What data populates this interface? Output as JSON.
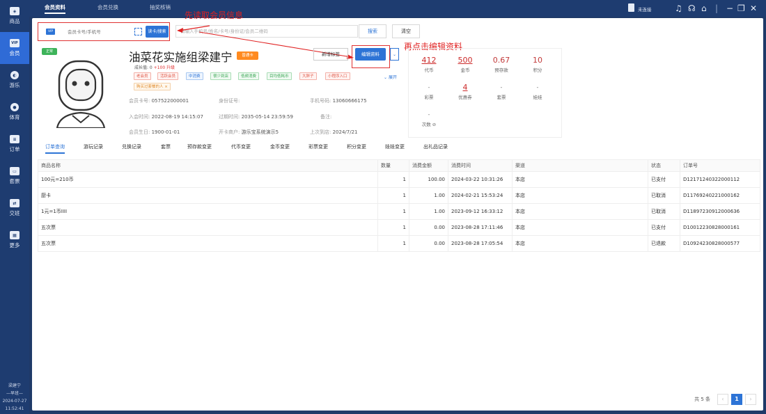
{
  "sidebar": {
    "items": [
      {
        "label": "商品",
        "icon": "shop-icon"
      },
      {
        "label": "会员",
        "icon": "vip-icon"
      },
      {
        "label": "游乐",
        "icon": "game-icon"
      },
      {
        "label": "体育",
        "icon": "sport-icon"
      },
      {
        "label": "订单",
        "icon": "order-icon"
      },
      {
        "label": "套票",
        "icon": "ticket-icon"
      },
      {
        "label": "交班",
        "icon": "shift-icon"
      },
      {
        "label": "更多",
        "icon": "more-icon"
      }
    ],
    "user": "梁建宁",
    "shift": "早班",
    "date": "2024-07-27",
    "time": "11:52:41"
  },
  "topbar": {
    "tabs": [
      "会员资料",
      "会员兑换",
      "抽奖核销"
    ],
    "device_status": "未连接"
  },
  "search": {
    "vip": "VIP",
    "card_placeholder": "会员卡号/手机号",
    "read_button": "读卡/搜索",
    "query_placeholder": "请输入手机号/姓名/卡号/身份证/会员二维码",
    "search_button": "搜索",
    "clear_button": "清空"
  },
  "annotations": {
    "step1": "先读取会员信息",
    "step2": "再点击编辑资料"
  },
  "member": {
    "level_tag": "正常",
    "name": "油菜花实施组梁建宁",
    "card_type": "普通卡",
    "growth_label": "成长值: 0",
    "growth_extra": "+100 升级",
    "tags": [
      "老会员",
      "活跃会员",
      "中消费",
      "很少到店",
      "低频消费",
      "目均低耗币",
      "大胖子",
      "小程序入口",
      "购买过套餐的人"
    ],
    "expand": "展开",
    "add_tag_button": "新增标签",
    "edit_button": "编辑资料",
    "card_no_label": "会员卡号:",
    "card_no": "057522000001",
    "id_label": "身份证号:",
    "id_value": "",
    "phone_label": "手机号码:",
    "phone": "13060666175",
    "join_label": "入会时间:",
    "join_time": "2022-08-19 14:15:07",
    "expire_label": "过期时间:",
    "expire_time": "2035-05-14 23:59:59",
    "remark_label": "备注:",
    "remark": "",
    "birthday_label": "会员生日:",
    "birthday": "1900-01-01",
    "store_label": "开卡商户:",
    "store": "游乐宝系统演示5",
    "last_visit_label": "上次到店:",
    "last_visit": "2024/7/21"
  },
  "stats": {
    "row1": [
      {
        "value": "412",
        "label": "代币"
      },
      {
        "value": "500",
        "label": "金币"
      },
      {
        "value": "0.67",
        "label": "预存款"
      },
      {
        "value": "10",
        "label": "积分"
      }
    ],
    "row2": [
      {
        "value": "-",
        "label": "彩票"
      },
      {
        "value": "4",
        "label": "优惠券"
      },
      {
        "value": "-",
        "label": "套票"
      },
      {
        "value": "-",
        "label": "娃娃"
      }
    ],
    "row3": [
      {
        "value": "-",
        "label": "次数 ⊘"
      }
    ]
  },
  "subtabs": [
    "订单查询",
    "游玩记录",
    "兑换记录",
    "套票",
    "预存款变更",
    "代币变更",
    "金币变更",
    "彩票变更",
    "积分变更",
    "娃娃变更",
    "出礼品记录"
  ],
  "table": {
    "headers": [
      "商品名称",
      "数量",
      "消费金额",
      "消费时间",
      "渠道",
      "状态",
      "订单号"
    ],
    "rows": [
      [
        "100元=210币",
        "1",
        "100.00",
        "2024-03-22 10:31:26",
        "本店",
        "已支付",
        "D12171240322000112"
      ],
      [
        "厨卡",
        "1",
        "1.00",
        "2024-02-21 15:53:24",
        "本店",
        "已取消",
        "D11769240221000162"
      ],
      [
        "1元=1币IIII",
        "1",
        "1.00",
        "2023-09-12 16:33:12",
        "本店",
        "已取消",
        "D11897230912000636"
      ],
      [
        "五次票",
        "1",
        "0.00",
        "2023-08-28 17:11:46",
        "本店",
        "已支付",
        "D10012230828000161"
      ],
      [
        "五次票",
        "1",
        "0.00",
        "2023-08-28 17:05:54",
        "本店",
        "已退款",
        "D10924230828000577"
      ]
    ]
  },
  "pager": {
    "total": "共 5 条",
    "prev": "‹",
    "page": "1",
    "next": "›"
  },
  "colors": {
    "primary": "#2d74d6",
    "sidebar": "#1e3c70",
    "annotation": "#e02020",
    "accent_orange": "#ff8a1f",
    "tag_green": "#3db35a"
  }
}
